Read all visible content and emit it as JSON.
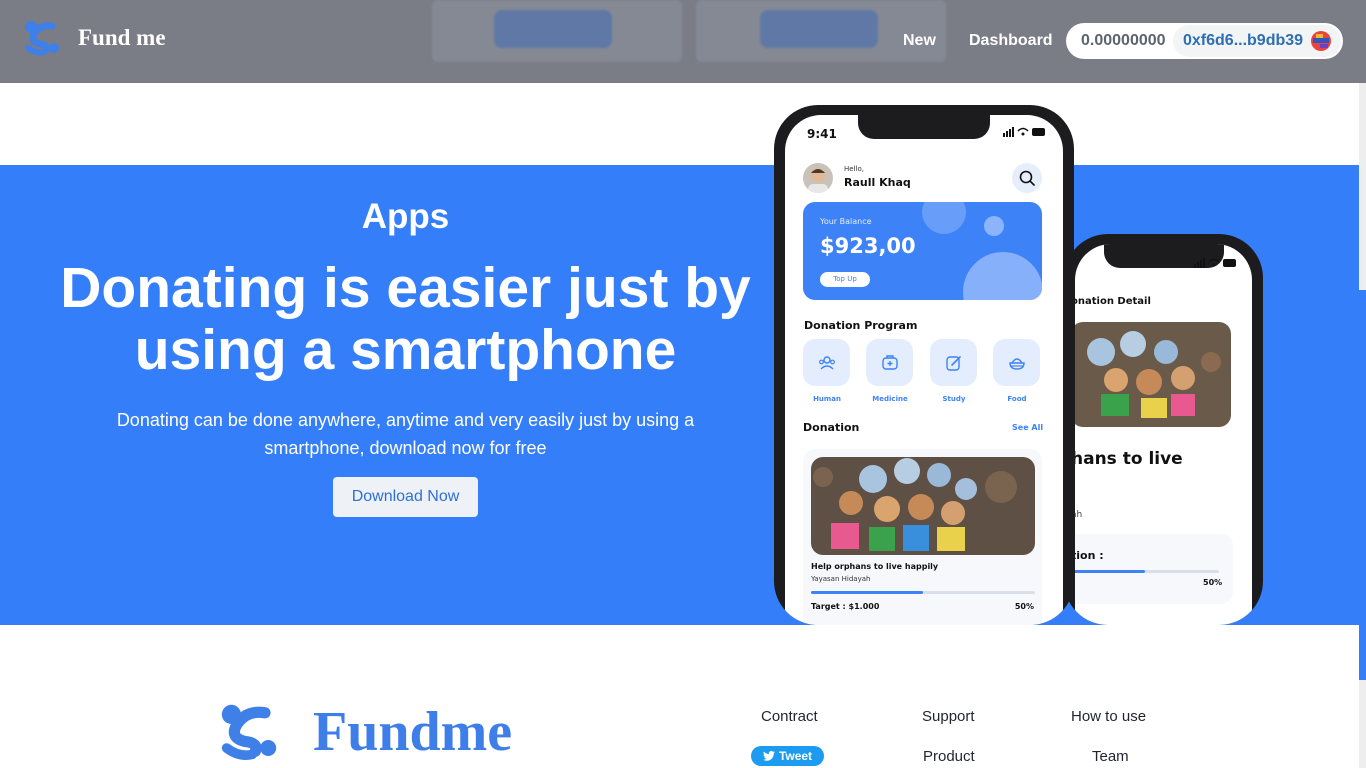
{
  "navbar": {
    "brand": "Fund me",
    "links": [
      "New",
      "Dashboard"
    ],
    "wallet": {
      "balance": "0.00000000",
      "address": "0xf6d6...b9db39"
    }
  },
  "hero": {
    "eyebrow": "Apps",
    "title": "Donating is easier just by using a smartphone",
    "subtitle": "Donating can be done anywhere, anytime and very easily just by using a smartphone, download now for free",
    "cta": "Download Now"
  },
  "phone_front": {
    "time": "9:41",
    "greeting": "Hello,",
    "user_name": "Raull Khaq",
    "balance_label": "Your Balance",
    "balance_amount": "$923,00",
    "topup_label": "Top Up",
    "program_title": "Donation Program",
    "categories": [
      "Human",
      "Medicine",
      "Study",
      "Food"
    ],
    "donation_title": "Donation",
    "see_all": "See All",
    "card": {
      "title": "Help orphans to live happily",
      "org": "Yayasan Hidayah",
      "target": "Target : $1.000",
      "progress": 0.5,
      "percent": "50%"
    }
  },
  "phone_back": {
    "header": "onation Detail",
    "headline": "hans to live",
    "org_fragment": "ah",
    "label_fragment": "tion :",
    "progress": 0.5,
    "percent": "50%"
  },
  "footer": {
    "brand": "Fundme",
    "columns": [
      [
        "Contract",
        "Support",
        "How to use"
      ],
      [
        "Product",
        "Team"
      ]
    ],
    "tweet": "Tweet"
  },
  "colors": {
    "brand_blue": "#347ef9",
    "navbar": "#7a7d86",
    "address_text": "#2d6fb0"
  },
  "icons": [
    "fundme-logo",
    "search-icon",
    "human-icon",
    "medicine-icon",
    "study-icon",
    "food-icon",
    "twitter-icon",
    "wallet-avatar-icon"
  ]
}
